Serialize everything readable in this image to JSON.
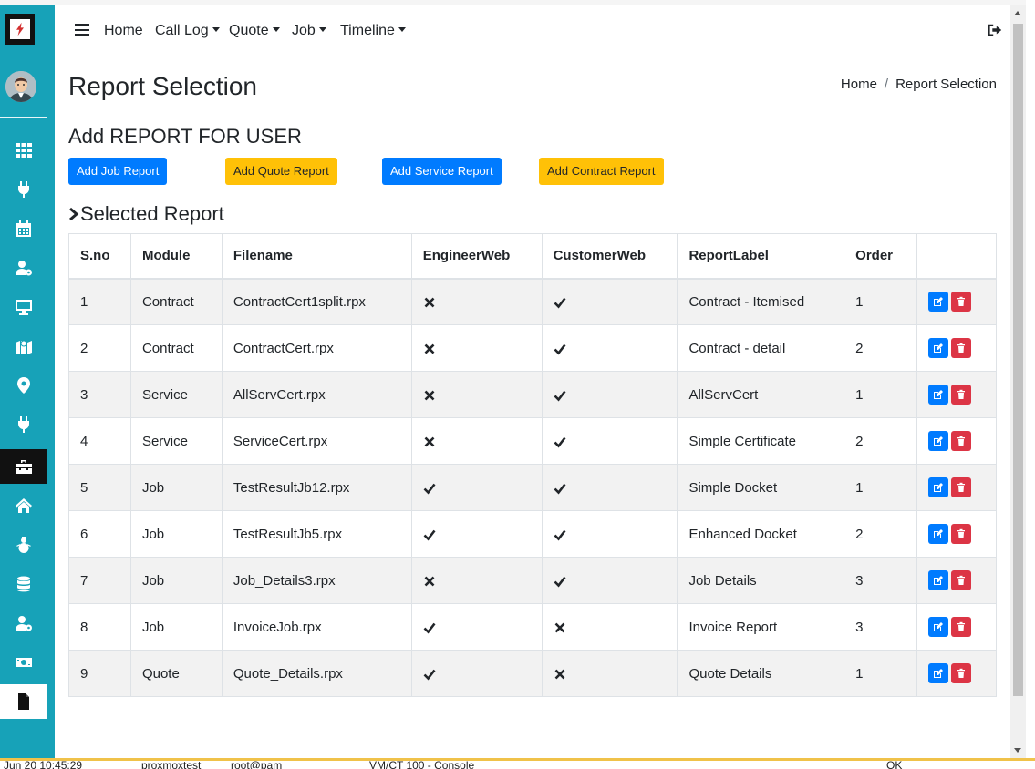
{
  "navbar": {
    "items": [
      {
        "label": "Home",
        "dropdown": false
      },
      {
        "label": "Call Log",
        "dropdown": true
      },
      {
        "label": "Quote",
        "dropdown": true
      },
      {
        "label": "Job",
        "dropdown": true
      },
      {
        "label": "Timeline",
        "dropdown": true
      }
    ],
    "logout_icon": "sign-out-icon"
  },
  "sidebar": {
    "icons": [
      "grid-icon",
      "plug-icon",
      "calendar-icon",
      "user-cog-icon",
      "monitor-icon",
      "map-icon",
      "map-marker-icon",
      "plug-icon",
      "toolbox-icon",
      "home-icon",
      "snowman-icon",
      "database-icon",
      "user-cog-icon",
      "money-bill-icon",
      "file-icon"
    ],
    "active_index": 8,
    "selected_index": 14
  },
  "page": {
    "title": "Report Selection",
    "breadcrumb": {
      "home": "Home",
      "separator": "/",
      "current": "Report Selection"
    }
  },
  "add_section": {
    "title": "Add REPORT FOR USER",
    "buttons": {
      "job": "Add Job Report",
      "quote": "Add Quote Report",
      "service": "Add Service Report",
      "contract": "Add Contract Report"
    }
  },
  "selected": {
    "title": "Selected Report",
    "columns": [
      "S.no",
      "Module",
      "Filename",
      "EngineerWeb",
      "CustomerWeb",
      "ReportLabel",
      "Order",
      ""
    ],
    "rows": [
      {
        "sno": "1",
        "module": "Contract",
        "filename": "ContractCert1split.rpx",
        "engineer": false,
        "customer": true,
        "label": "Contract - Itemised",
        "order": "1"
      },
      {
        "sno": "2",
        "module": "Contract",
        "filename": "ContractCert.rpx",
        "engineer": false,
        "customer": true,
        "label": "Contract - detail",
        "order": "2"
      },
      {
        "sno": "3",
        "module": "Service",
        "filename": "AllServCert.rpx",
        "engineer": false,
        "customer": true,
        "label": "AllServCert",
        "order": "1"
      },
      {
        "sno": "4",
        "module": "Service",
        "filename": "ServiceCert.rpx",
        "engineer": false,
        "customer": true,
        "label": "Simple Certificate",
        "order": "2"
      },
      {
        "sno": "5",
        "module": "Job",
        "filename": "TestResultJb12.rpx",
        "engineer": true,
        "customer": true,
        "label": "Simple Docket",
        "order": "1"
      },
      {
        "sno": "6",
        "module": "Job",
        "filename": "TestResultJb5.rpx",
        "engineer": true,
        "customer": true,
        "label": "Enhanced Docket",
        "order": "2"
      },
      {
        "sno": "7",
        "module": "Job",
        "filename": "Job_Details3.rpx",
        "engineer": false,
        "customer": true,
        "label": "Job Details",
        "order": "3"
      },
      {
        "sno": "8",
        "module": "Job",
        "filename": "InvoiceJob.rpx",
        "engineer": true,
        "customer": false,
        "label": "Invoice Report",
        "order": "3"
      },
      {
        "sno": "9",
        "module": "Quote",
        "filename": "Quote_Details.rpx",
        "engineer": true,
        "customer": false,
        "label": "Quote Details",
        "order": "1"
      }
    ]
  },
  "colors": {
    "sidebar": "#17a2b8",
    "primary": "#007bff",
    "warning": "#ffc107",
    "danger": "#dc3545"
  },
  "status_strip": {
    "date": "Jun 20 10:45:29",
    "node": "proxmoxtest",
    "user": "root@pam",
    "task": "VM/CT 100 - Console",
    "status": "OK"
  }
}
